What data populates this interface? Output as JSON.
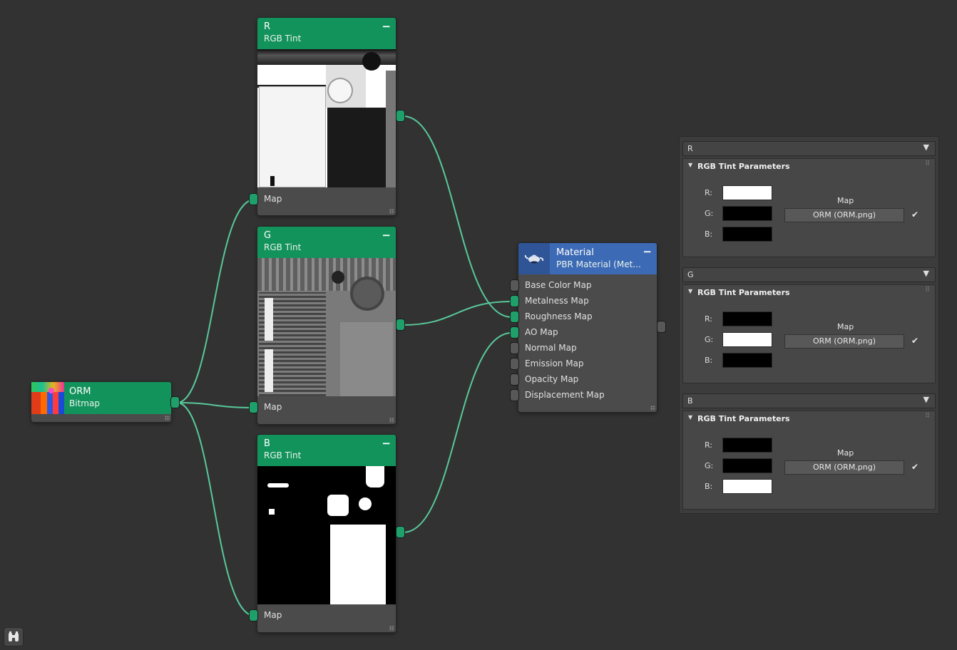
{
  "nodes": {
    "orm": {
      "title": "ORM",
      "subtitle": "Bitmap",
      "header_color": "#13935c"
    },
    "r": {
      "title": "R",
      "subtitle": "RGB Tint",
      "input_label": "Map",
      "header_color": "#13935c"
    },
    "g": {
      "title": "G",
      "subtitle": "RGB Tint",
      "input_label": "Map",
      "header_color": "#13935c"
    },
    "b": {
      "title": "B",
      "subtitle": "RGB Tint",
      "input_label": "Map",
      "header_color": "#13935c"
    },
    "material": {
      "title": "Material",
      "subtitle": "PBR Material (Met...",
      "header_color": "#3d6ab5",
      "inputs": [
        {
          "label": "Base Color Map",
          "connected": false
        },
        {
          "label": "Metalness Map",
          "connected": true
        },
        {
          "label": "Roughness Map",
          "connected": true
        },
        {
          "label": "AO Map",
          "connected": true
        },
        {
          "label": "Normal Map",
          "connected": false
        },
        {
          "label": "Emission Map",
          "connected": false
        },
        {
          "label": "Opacity Map",
          "connected": false
        },
        {
          "label": "Displacement Map",
          "connected": false
        }
      ]
    }
  },
  "parameters": {
    "rollouts": [
      {
        "name": "R",
        "group_title": "RGB Tint Parameters",
        "r": "#ffffff",
        "g": "#000000",
        "b": "#000000",
        "map_label": "Map",
        "map_value": "ORM (ORM.png)",
        "map_enabled": true
      },
      {
        "name": "G",
        "group_title": "RGB Tint Parameters",
        "r": "#000000",
        "g": "#ffffff",
        "b": "#000000",
        "map_label": "Map",
        "map_value": "ORM (ORM.png)",
        "map_enabled": true
      },
      {
        "name": "B",
        "group_title": "RGB Tint Parameters",
        "r": "#000000",
        "g": "#000000",
        "b": "#ffffff",
        "map_label": "Map",
        "map_value": "ORM (ORM.png)",
        "map_enabled": true
      }
    ],
    "channel_labels": {
      "r": "R:",
      "g": "G:",
      "b": "B:"
    }
  },
  "colors": {
    "wire": "#58c89a",
    "socket_connected": "#1fa06b",
    "socket_empty": "#585858",
    "canvas": "#323232"
  },
  "icons": {
    "material_icon": "teapot-icon",
    "toolbar_button": "binoculars-icon",
    "dropdown": "dropdown-triangle-icon",
    "check": "checkmark-icon"
  }
}
